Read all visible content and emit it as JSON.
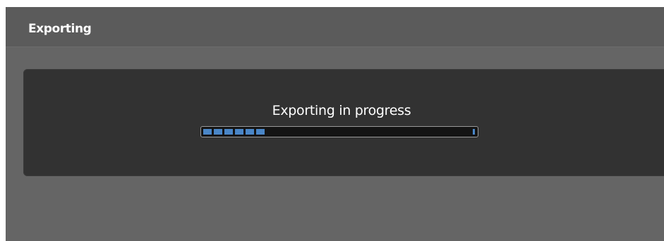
{
  "dialog": {
    "title": "Exporting",
    "status_text": "Exporting in progress",
    "progress_percent": 25
  },
  "colors": {
    "dialog_background": "#656565",
    "title_bar": "#5b5b5b",
    "panel": "#323232",
    "progress_track": "#141414",
    "progress_fill": "#4a86c7",
    "text": "#ffffff"
  }
}
